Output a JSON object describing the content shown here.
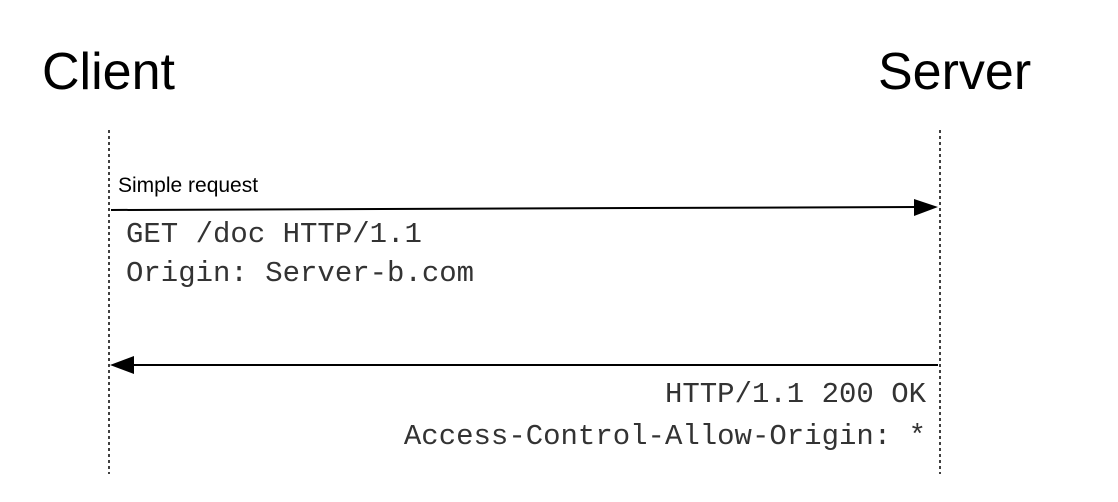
{
  "actors": {
    "client": "Client",
    "server": "Server"
  },
  "request": {
    "label": "Simple request",
    "lines": [
      "GET /doc HTTP/1.1",
      "Origin: Server-b.com"
    ]
  },
  "response": {
    "lines": [
      "HTTP/1.1 200 OK",
      "Access-Control-Allow-Origin: *"
    ]
  }
}
